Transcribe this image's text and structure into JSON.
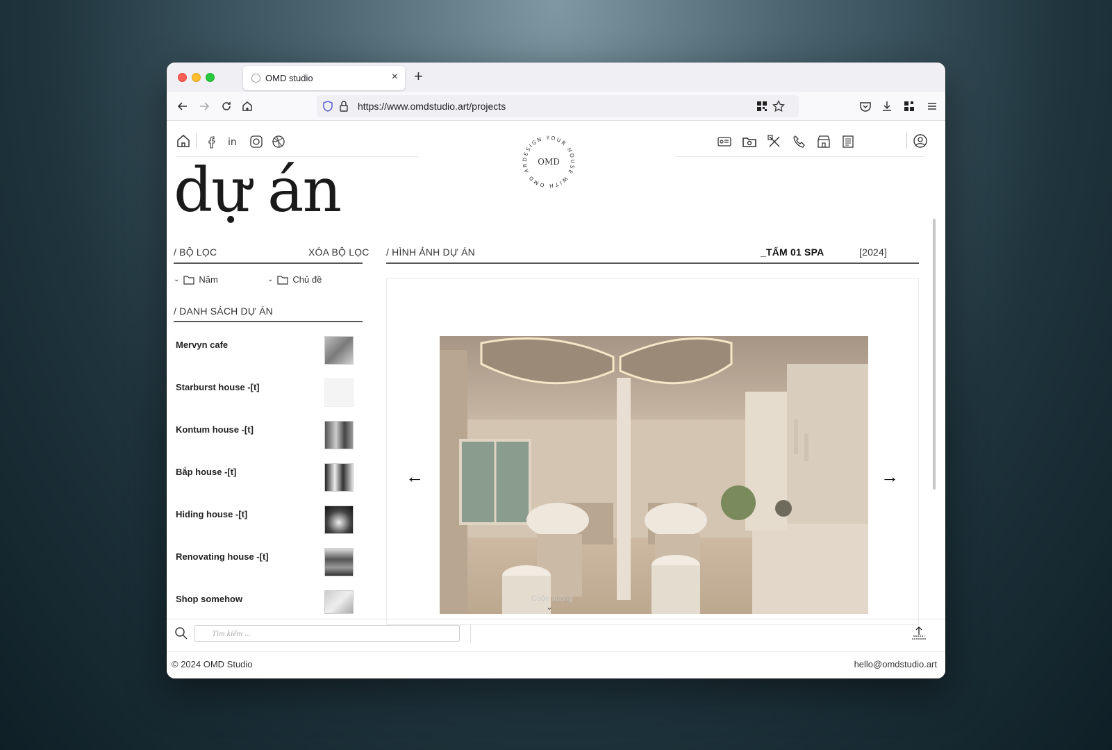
{
  "browser": {
    "tab_title": "OMD studio",
    "url": "https://www.omdstudio.art/projects"
  },
  "header": {
    "logo_text": "OMD",
    "logo_ring_text": "DESIGN YOUR HOUSE WITH OMD ARCHITECT"
  },
  "page": {
    "title": "dự án"
  },
  "filter": {
    "label": "/ BỘ LỌC",
    "clear_label": "XÓA BỘ LỌC",
    "year_label": "Năm",
    "topic_label": "Chủ đề"
  },
  "projects": {
    "label": "/ DANH SÁCH DỰ ÁN",
    "items": [
      {
        "name": "Mervyn cafe"
      },
      {
        "name": "Starburst house -[t]"
      },
      {
        "name": "Kontum house -[t]"
      },
      {
        "name": "Bắp house -[t]"
      },
      {
        "name": "Hiding house -[t]"
      },
      {
        "name": "Renovating house -[t]"
      },
      {
        "name": "Shop somehow"
      }
    ]
  },
  "gallery": {
    "label": "/ HÌNH ẢNH DỰ ÁN",
    "project_name": "_TẤM 01 SPA",
    "year": "[2024]",
    "scroll_hint": "Cuộn xuống"
  },
  "search": {
    "placeholder": "Tìm kiếm ..."
  },
  "footer": {
    "copyright": "© 2024 OMD Studio",
    "email": "hello@omdstudio.art"
  },
  "colors": {
    "accent": "#1a1a1a",
    "background": "#ffffff"
  }
}
